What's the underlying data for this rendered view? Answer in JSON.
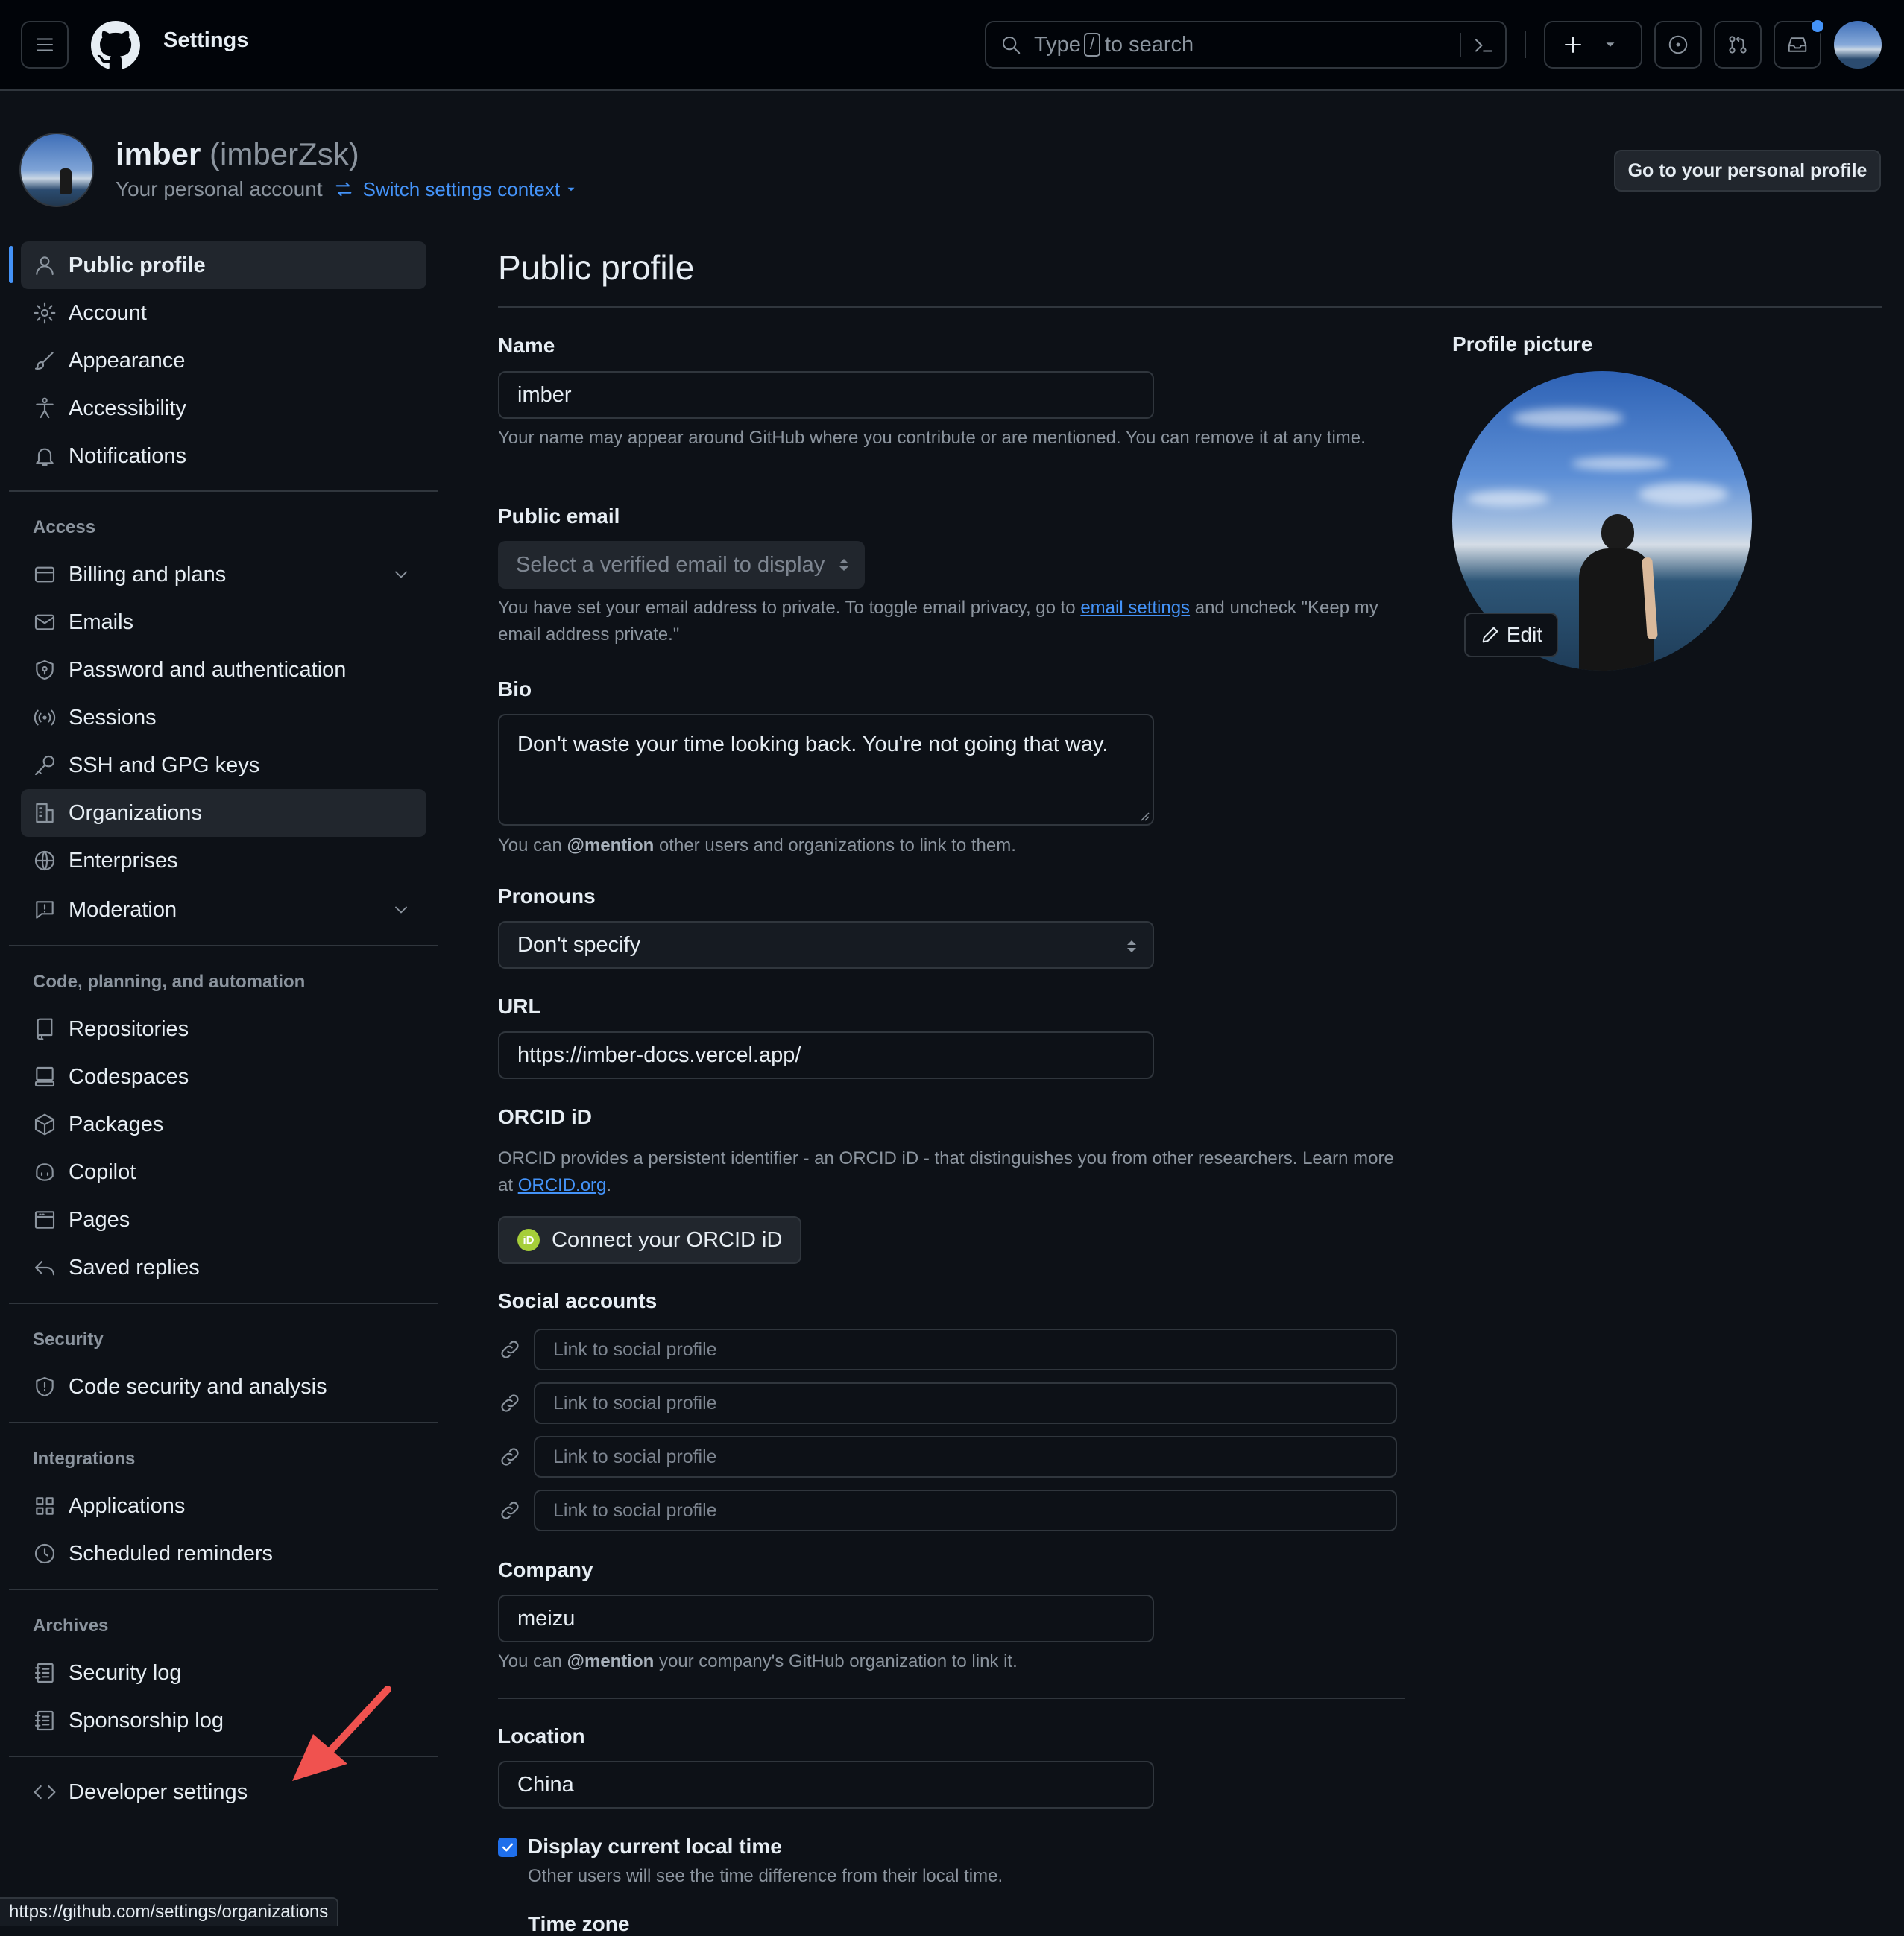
{
  "header": {
    "title": "Settings",
    "search": {
      "prefix": "Type",
      "key": "/",
      "suffix": "to search"
    },
    "icons": [
      "hamburger-icon",
      "github-logo-icon",
      "search-icon",
      "command-palette-icon",
      "plus-icon",
      "triangle-down-icon",
      "issue-icon",
      "pull-request-icon",
      "inbox-icon",
      "avatar"
    ]
  },
  "account": {
    "name": "imber",
    "login": "(imberZsk)",
    "subtitle": "Your personal account",
    "switch_label": "Switch settings context",
    "profile_button": "Go to your personal profile"
  },
  "sidebar": {
    "top": [
      {
        "label": "Public profile",
        "icon": "person-icon"
      },
      {
        "label": "Account",
        "icon": "gear-icon"
      },
      {
        "label": "Appearance",
        "icon": "paintbrush-icon"
      },
      {
        "label": "Accessibility",
        "icon": "accessibility-icon"
      },
      {
        "label": "Notifications",
        "icon": "bell-icon"
      }
    ],
    "access_heading": "Access",
    "access": [
      {
        "label": "Billing and plans",
        "icon": "credit-card-icon"
      },
      {
        "label": "Emails",
        "icon": "mail-icon"
      },
      {
        "label": "Password and authentication",
        "icon": "shield-lock-icon"
      },
      {
        "label": "Sessions",
        "icon": "broadcast-icon"
      },
      {
        "label": "SSH and GPG keys",
        "icon": "key-icon"
      },
      {
        "label": "Organizations",
        "icon": "organization-icon"
      },
      {
        "label": "Enterprises",
        "icon": "globe-icon"
      },
      {
        "label": "Moderation",
        "icon": "report-icon"
      }
    ],
    "code_heading": "Code, planning, and automation",
    "code": [
      {
        "label": "Repositories",
        "icon": "repo-icon"
      },
      {
        "label": "Codespaces",
        "icon": "codespaces-icon"
      },
      {
        "label": "Packages",
        "icon": "package-icon"
      },
      {
        "label": "Copilot",
        "icon": "copilot-icon"
      },
      {
        "label": "Pages",
        "icon": "browser-icon"
      },
      {
        "label": "Saved replies",
        "icon": "reply-icon"
      }
    ],
    "security_heading": "Security",
    "security": [
      {
        "label": "Code security and analysis",
        "icon": "shield-icon"
      }
    ],
    "integrations_heading": "Integrations",
    "integrations": [
      {
        "label": "Applications",
        "icon": "apps-icon"
      },
      {
        "label": "Scheduled reminders",
        "icon": "clock-icon"
      }
    ],
    "archives_heading": "Archives",
    "archives": [
      {
        "label": "Security log",
        "icon": "log-icon"
      },
      {
        "label": "Sponsorship log",
        "icon": "log-icon"
      }
    ],
    "developer": {
      "label": "Developer settings",
      "icon": "code-icon"
    }
  },
  "main": {
    "title": "Public profile",
    "name": {
      "label": "Name",
      "value": "imber",
      "note": "Your name may appear around GitHub where you contribute or are mentioned. You can remove it at any time."
    },
    "public_email": {
      "label": "Public email",
      "placeholder": "Select a verified email to display",
      "note_before": "You have set your email address to private. To toggle email privacy, go to",
      "note_link": "email settings",
      "note_after": "and uncheck \"Keep my email address private.\""
    },
    "bio": {
      "label": "Bio",
      "value": "Don't waste your time looking back. You're not going that way.",
      "note_before": "You can",
      "note_mention": "@mention",
      "note_after": "other users and organizations to link to them."
    },
    "pronouns": {
      "label": "Pronouns",
      "value": "Don't specify"
    },
    "url": {
      "label": "URL",
      "value": "https://imber-docs.vercel.app/"
    },
    "orcid": {
      "label": "ORCID iD",
      "note_before": "ORCID provides a persistent identifier - an ORCID iD - that distinguishes you from other researchers. Learn more at",
      "note_link": "ORCID.org",
      "note_after": ".",
      "badge": "iD",
      "button": "Connect your ORCID iD"
    },
    "social": {
      "label": "Social accounts",
      "placeholders": [
        "Link to social profile",
        "Link to social profile",
        "Link to social profile",
        "Link to social profile"
      ]
    },
    "company": {
      "label": "Company",
      "value": "meizu",
      "note_before": "You can",
      "note_mention": "@mention",
      "note_after": "your company's GitHub organization to link it."
    },
    "location": {
      "label": "Location",
      "value": "China"
    },
    "local_time": {
      "checked": true,
      "label": "Display current local time",
      "note": "Other users will see the time difference from their local time."
    },
    "time_zone_label": "Time zone"
  },
  "profile_picture": {
    "label": "Profile picture",
    "edit": "Edit"
  },
  "status_bar": {
    "url": "https://github.com/settings/organizations"
  },
  "colors": {
    "accent": "#4493f8",
    "annotation_arrow": "#f0524f",
    "checkbox": "#1f6feb",
    "orcid": "#a6ce39"
  }
}
